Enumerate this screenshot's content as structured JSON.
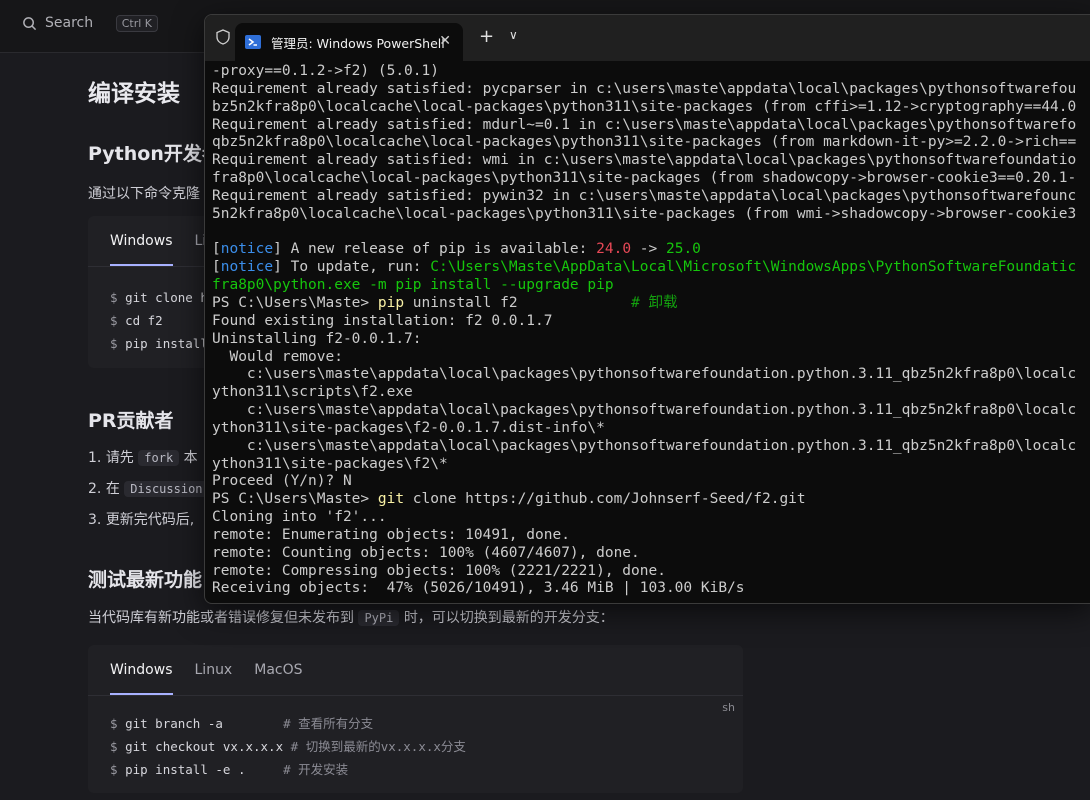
{
  "topbar": {
    "search_label": "Search",
    "shortcut": "Ctrl K"
  },
  "doc": {
    "h1": "编译安装",
    "h2_python": "Python开发者",
    "p_clone": "通过以下命令克隆",
    "tabs1": [
      "Windows",
      "Li"
    ],
    "code1": [
      {
        "cmd": "git clone h"
      },
      {
        "cmd": "cd f2"
      },
      {
        "cmd": "pip install"
      }
    ],
    "h2_pr": "PR贡献者",
    "pr_items": [
      {
        "num": "1.",
        "pre": "请先",
        "code": "fork",
        "post": "本"
      },
      {
        "num": "2.",
        "pre": "在",
        "code": "Discussion",
        "post": ""
      },
      {
        "num": "3.",
        "pre": "更新完代码后,",
        "code": "",
        "post": ""
      }
    ],
    "h2_test": "测试最新功能",
    "p_test_pre": "当代码库有新功能或者错误修复但未发布到",
    "p_test_code": "PyPi",
    "p_test_post": "时，可以切换到最新的开发分支：",
    "tabs2": [
      "Windows",
      "Linux",
      "MacOS"
    ],
    "lang2": "sh",
    "code2": [
      {
        "cmd": "git branch -a       ",
        "comment": "# 查看所有分支"
      },
      {
        "cmd": "git checkout vx.x.x.x",
        "comment": "# 切换到最新的vx.x.x.x分支"
      },
      {
        "cmd": "pip install -e .    ",
        "comment": "# 开发安装"
      }
    ]
  },
  "terminal": {
    "tab_title": "管理员: Windows PowerShell",
    "lines": [
      [
        {
          "t": "-proxy==0.1.2->f2) (5.0.1)"
        }
      ],
      [
        {
          "t": "Requirement already satisfied: pycparser in c:\\users\\maste\\appdata\\local\\packages\\pythonsoftwarefou"
        }
      ],
      [
        {
          "t": "bz5n2kfra8p0\\localcache\\local-packages\\python311\\site-packages (from cffi>=1.12->cryptography==44.0"
        }
      ],
      [
        {
          "t": "Requirement already satisfied: mdurl~=0.1 in c:\\users\\maste\\appdata\\local\\packages\\pythonsoftwarefo"
        }
      ],
      [
        {
          "t": "qbz5n2kfra8p0\\localcache\\local-packages\\python311\\site-packages (from markdown-it-py>=2.2.0->rich=="
        }
      ],
      [
        {
          "t": "Requirement already satisfied: wmi in c:\\users\\maste\\appdata\\local\\packages\\pythonsoftwarefoundatio"
        }
      ],
      [
        {
          "t": "fra8p0\\localcache\\local-packages\\python311\\site-packages (from shadowcopy->browser-cookie3==0.20.1-"
        }
      ],
      [
        {
          "t": "Requirement already satisfied: pywin32 in c:\\users\\maste\\appdata\\local\\packages\\pythonsoftwarefounc"
        }
      ],
      [
        {
          "t": "5n2kfra8p0\\localcache\\local-packages\\python311\\site-packages (from wmi->shadowcopy->browser-cookie3"
        }
      ],
      [
        {
          "t": ""
        }
      ],
      [
        {
          "t": "["
        },
        {
          "t": "notice",
          "c": "c-blue"
        },
        {
          "t": "] A new release of pip is available: "
        },
        {
          "t": "24.0",
          "c": "c-red"
        },
        {
          "t": " -> "
        },
        {
          "t": "25.0",
          "c": "c-green"
        }
      ],
      [
        {
          "t": "["
        },
        {
          "t": "notice",
          "c": "c-blue"
        },
        {
          "t": "] To update, run: "
        },
        {
          "t": "C:\\Users\\Maste\\AppData\\Local\\Microsoft\\WindowsApps\\PythonSoftwareFoundatic",
          "c": "c-green"
        }
      ],
      [
        {
          "t": "fra8p0\\python.exe -m pip install --upgrade pip",
          "c": "c-green"
        }
      ],
      [
        {
          "t": "PS C:\\Users\\Maste> "
        },
        {
          "t": "pip",
          "c": "c-yellow"
        },
        {
          "t": " uninstall f2             "
        },
        {
          "t": "# 卸载",
          "c": "c-cmt"
        }
      ],
      [
        {
          "t": "Found existing installation: f2 0.0.1.7"
        }
      ],
      [
        {
          "t": "Uninstalling f2-0.0.1.7:"
        }
      ],
      [
        {
          "t": "  Would remove:"
        }
      ],
      [
        {
          "t": "    c:\\users\\maste\\appdata\\local\\packages\\pythonsoftwarefoundation.python.3.11_qbz5n2kfra8p0\\localc"
        }
      ],
      [
        {
          "t": "ython311\\scripts\\f2.exe"
        }
      ],
      [
        {
          "t": "    c:\\users\\maste\\appdata\\local\\packages\\pythonsoftwarefoundation.python.3.11_qbz5n2kfra8p0\\localc"
        }
      ],
      [
        {
          "t": "ython311\\site-packages\\f2-0.0.1.7.dist-info\\*"
        }
      ],
      [
        {
          "t": "    c:\\users\\maste\\appdata\\local\\packages\\pythonsoftwarefoundation.python.3.11_qbz5n2kfra8p0\\localc"
        }
      ],
      [
        {
          "t": "ython311\\site-packages\\f2\\*"
        }
      ],
      [
        {
          "t": "Proceed (Y/n)? N"
        }
      ],
      [
        {
          "t": "PS C:\\Users\\Maste> "
        },
        {
          "t": "git",
          "c": "c-yellow"
        },
        {
          "t": " clone https://github.com/Johnserf-Seed/f2.git"
        }
      ],
      [
        {
          "t": "Cloning into 'f2'..."
        }
      ],
      [
        {
          "t": "remote: Enumerating objects: 10491, done."
        }
      ],
      [
        {
          "t": "remote: Counting objects: 100% (4607/4607), done."
        }
      ],
      [
        {
          "t": "remote: Compressing objects: 100% (2221/2221), done."
        }
      ],
      [
        {
          "t": "Receiving objects:  47% (5026/10491), 3.46 MiB | 103.00 KiB/s"
        }
      ]
    ]
  }
}
